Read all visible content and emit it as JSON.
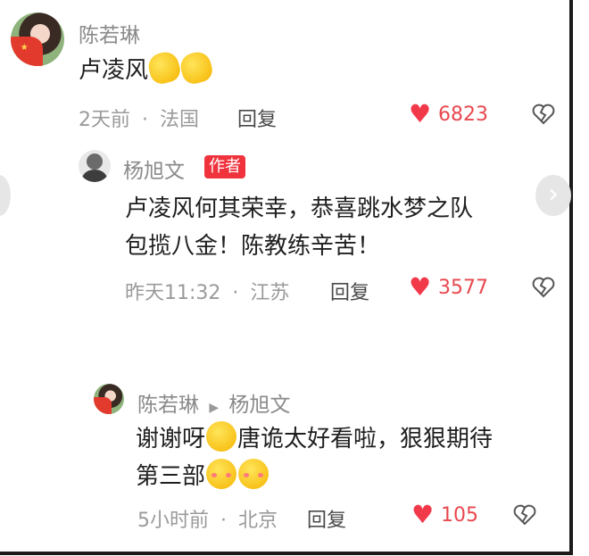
{
  "comment": {
    "username": "陈若琳",
    "text": "卢凌风",
    "emoji": [
      "waving-hand-emoji",
      "waving-hand-emoji"
    ],
    "time": "2天前",
    "location": "法国",
    "reply_label": "回复",
    "likes": "6823"
  },
  "author_reply": {
    "username": "杨旭文",
    "badge": "作者",
    "text_line1": "卢凌风何其荣幸，恭喜跳水梦之队",
    "text_line2": "包揽八金！陈教练辛苦！",
    "time": "昨天11:32",
    "location": "江苏",
    "reply_label": "回复",
    "likes": "3577"
  },
  "nested_reply": {
    "username": "陈若琳",
    "reply_to": "杨旭文",
    "text_line1_a": "谢谢呀",
    "text_line1_b": "唐诡太好看啦，狠狠期待",
    "text_line2": "第三部",
    "time": "5小时前",
    "location": "北京",
    "reply_label": "回复",
    "likes": "105"
  },
  "separator": "·",
  "colors": {
    "like_red": "#e8484f",
    "badge_red": "#f0323c",
    "meta_gray": "#9a9a9a"
  }
}
